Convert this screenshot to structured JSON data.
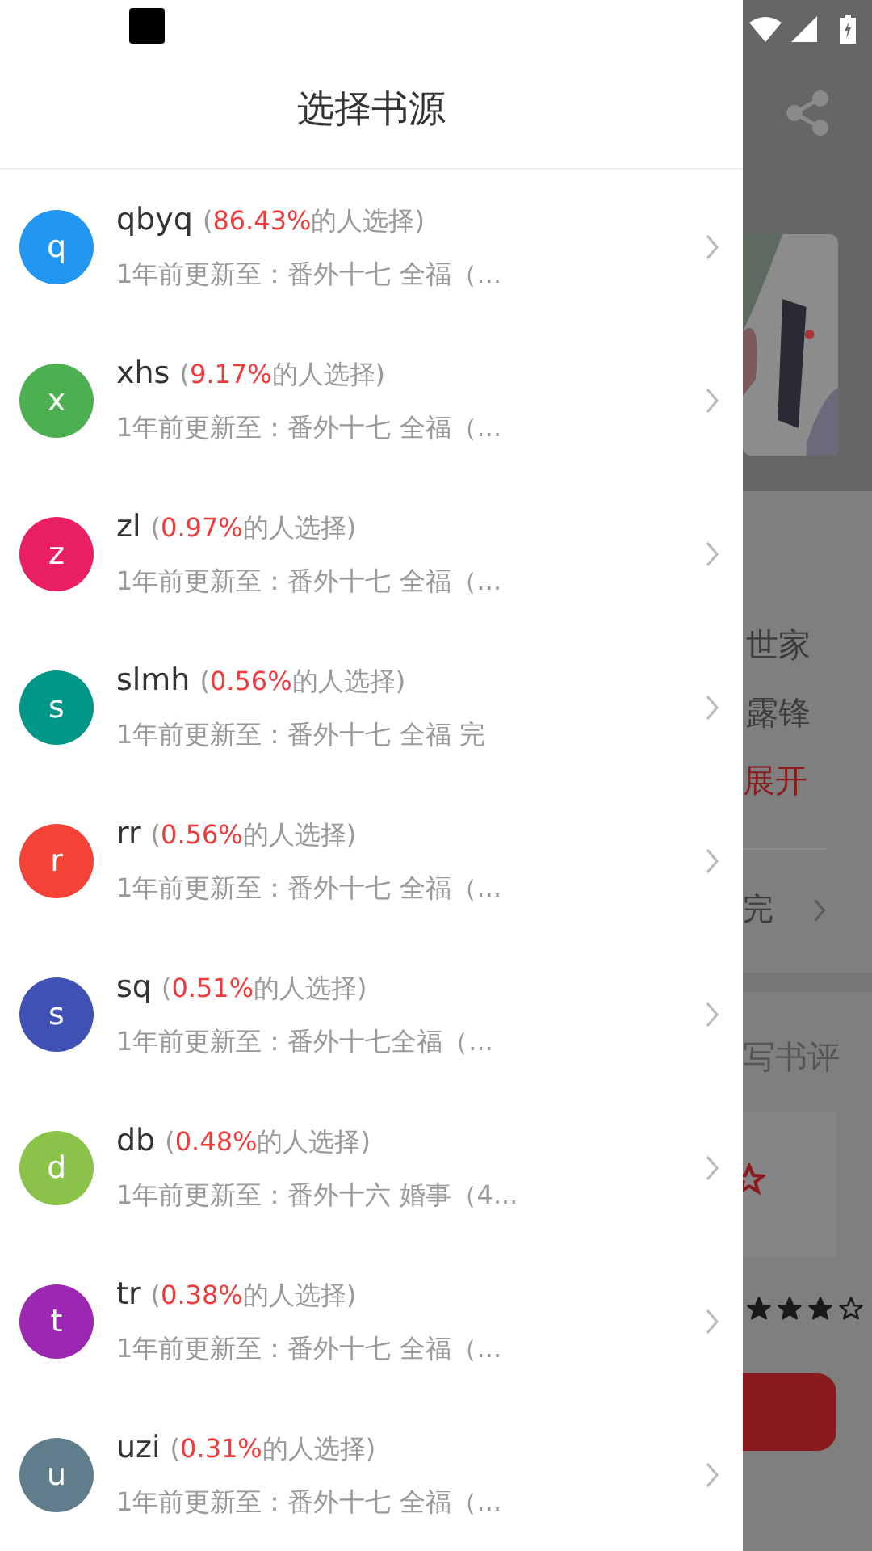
{
  "drawer": {
    "title": "选择书源",
    "sources": [
      {
        "letter": "q",
        "color": "#2196f3",
        "name": "qbyq",
        "stat_before": "(",
        "percent": "86.43%",
        "stat_after": "的人选择)",
        "update": "1年前更新至：番外十七 全福（..."
      },
      {
        "letter": "x",
        "color": "#4caf50",
        "name": "xhs",
        "stat_before": "(",
        "percent": "9.17%",
        "stat_after": "的人选择)",
        "update": "1年前更新至：番外十七 全福（..."
      },
      {
        "letter": "z",
        "color": "#e91e63",
        "name": "zl",
        "stat_before": "(",
        "percent": "0.97%",
        "stat_after": "的人选择)",
        "update": "1年前更新至：番外十七 全福（..."
      },
      {
        "letter": "s",
        "color": "#009688",
        "name": "slmh",
        "stat_before": "(",
        "percent": "0.56%",
        "stat_after": "的人选择)",
        "update": "1年前更新至：番外十七 全福 完"
      },
      {
        "letter": "r",
        "color": "#f44336",
        "name": "rr",
        "stat_before": "(",
        "percent": "0.56%",
        "stat_after": "的人选择)",
        "update": "1年前更新至：番外十七 全福（..."
      },
      {
        "letter": "s",
        "color": "#3f51b5",
        "name": "sq",
        "stat_before": "(",
        "percent": "0.51%",
        "stat_after": "的人选择)",
        "update": "1年前更新至：番外十七全福（..."
      },
      {
        "letter": "d",
        "color": "#8bc34a",
        "name": "db",
        "stat_before": "(",
        "percent": "0.48%",
        "stat_after": "的人选择)",
        "update": "1年前更新至：番外十六 婚事（4..."
      },
      {
        "letter": "t",
        "color": "#9c27b0",
        "name": "tr",
        "stat_before": "(",
        "percent": "0.38%",
        "stat_after": "的人选择)",
        "update": "1年前更新至：番外十七 全福（..."
      },
      {
        "letter": "u",
        "color": "#607d8b",
        "name": "uzi",
        "stat_before": "(",
        "percent": "0.31%",
        "stat_after": "的人选择)",
        "update": "1年前更新至：番外十七 全福（..."
      }
    ]
  },
  "background_page": {
    "intro_lines": [
      "世家",
      "露锋"
    ],
    "expand_link": "展开",
    "chapter": "完",
    "review_link": "写书评",
    "rating": {
      "stars": 3
    }
  }
}
